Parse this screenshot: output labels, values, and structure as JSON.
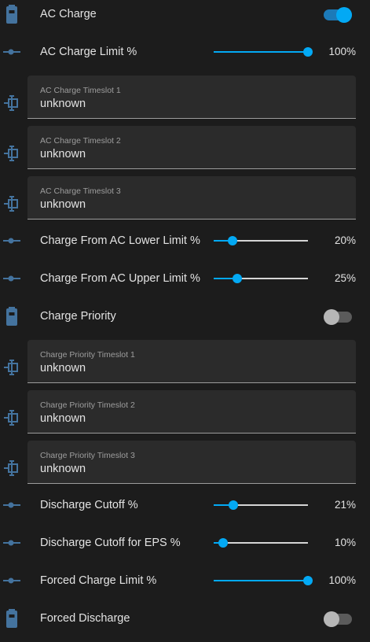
{
  "colors": {
    "accent": "#03a9f4",
    "icon": "#44739e",
    "background": "#1c1c1c"
  },
  "rows": [
    {
      "type": "toggle",
      "icon": "battery-icon",
      "label": "AC Charge",
      "on": true
    },
    {
      "type": "slider",
      "icon": "slider-icon",
      "label": "AC Charge Limit %",
      "value": "100%",
      "level": 100
    },
    {
      "type": "field",
      "icon": "timeslot-icon",
      "label": "AC Charge Timeslot 1",
      "value": "unknown"
    },
    {
      "type": "field",
      "icon": "timeslot-icon",
      "label": "AC Charge Timeslot 2",
      "value": "unknown"
    },
    {
      "type": "field",
      "icon": "timeslot-icon",
      "label": "AC Charge Timeslot 3",
      "value": "unknown"
    },
    {
      "type": "slider",
      "icon": "slider-icon",
      "label": "Charge From AC Lower Limit %",
      "value": "20%",
      "level": 20
    },
    {
      "type": "slider",
      "icon": "slider-icon",
      "label": "Charge From AC Upper Limit %",
      "value": "25%",
      "level": 25
    },
    {
      "type": "toggle",
      "icon": "battery-icon",
      "label": "Charge Priority",
      "on": false
    },
    {
      "type": "field",
      "icon": "timeslot-icon",
      "label": "Charge Priority Timeslot 1",
      "value": "unknown"
    },
    {
      "type": "field",
      "icon": "timeslot-icon",
      "label": "Charge Priority Timeslot 2",
      "value": "unknown"
    },
    {
      "type": "field",
      "icon": "timeslot-icon",
      "label": "Charge Priority Timeslot 3",
      "value": "unknown"
    },
    {
      "type": "slider",
      "icon": "slider-icon",
      "label": "Discharge Cutoff %",
      "value": "21%",
      "level": 21
    },
    {
      "type": "slider",
      "icon": "slider-icon",
      "label": "Discharge Cutoff for EPS %",
      "value": "10%",
      "level": 10
    },
    {
      "type": "slider",
      "icon": "slider-icon",
      "label": "Forced Charge Limit %",
      "value": "100%",
      "level": 100
    },
    {
      "type": "toggle",
      "icon": "battery-icon",
      "label": "Forced Discharge",
      "on": false
    }
  ]
}
